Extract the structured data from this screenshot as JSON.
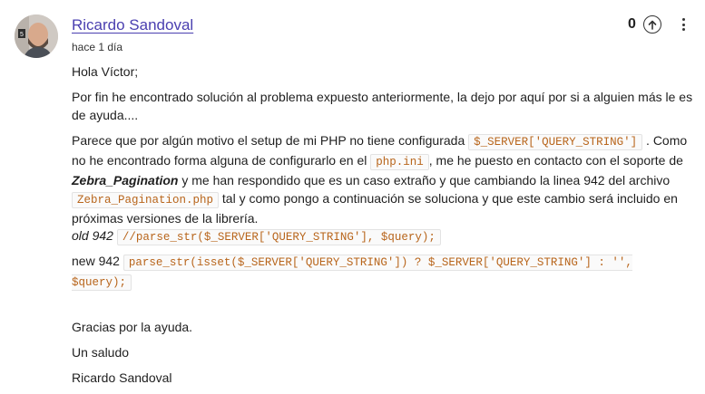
{
  "comment": {
    "author": "Ricardo Sandoval",
    "time": "hace 1 día",
    "votes": "0",
    "greeting": "Hola Víctor;",
    "intro": "Por fin he encontrado solución al problema expuesto anteriormente, la dejo por aquí por si a alguien más le es de ayuda....",
    "explain": {
      "t1": "Parece que por algún motivo el setup de mi PHP no tiene configurada ",
      "c1": "$_SERVER['QUERY_STRING']",
      "t2": " . Como no he encontrado forma alguna de configurarlo en el ",
      "c2": "php.ini",
      "t3": ", me he puesto en contacto con el soporte de ",
      "b1": "Zebra_Pagination",
      "t4": " y me han respondido que es un caso extraño y que cambiando la linea 942 del archivo ",
      "c3": "Zebra_Pagination.php",
      "t5": " tal y como pongo a continuación se soluciona y que este cambio será incluido en próximas versiones de la librería."
    },
    "old_label": "old 942",
    "old_code": "//parse_str($_SERVER['QUERY_STRING'], $query);",
    "new_label": "new 942",
    "new_code": "parse_str(isset($_SERVER['QUERY_STRING']) ? $_SERVER['QUERY_STRING'] : '', $query);",
    "thanks": "Gracias por la ayuda.",
    "regards": "Un saludo",
    "signature": "Ricardo Sandoval"
  },
  "icons": {
    "upvote": "arrow-up-circle-icon",
    "more": "more-vertical-icon"
  }
}
